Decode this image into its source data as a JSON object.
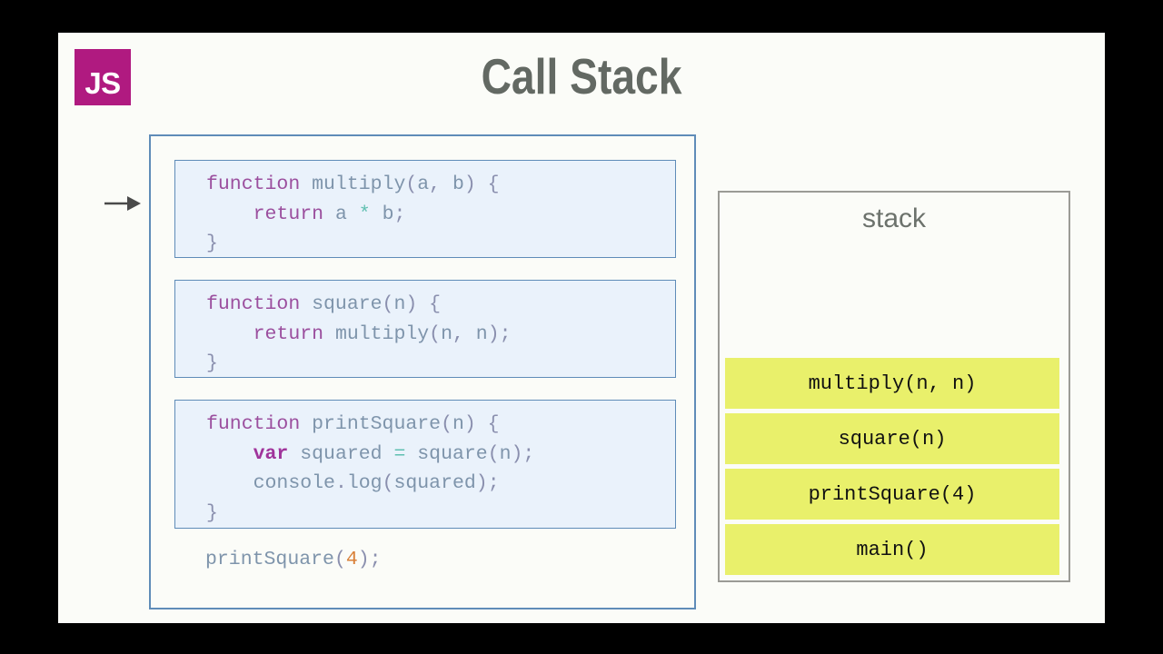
{
  "slide": {
    "title": "Call Stack",
    "logo_text": "JS",
    "logo_color": "#b01a80",
    "background": "#fbfcf8",
    "title_color": "#636963"
  },
  "pointer": {
    "icon": "right-arrow-icon",
    "points_to_line": "function multiply(a, b) {"
  },
  "code": {
    "border_color": "#5f8cb8",
    "box_fill": "#eaf2fb",
    "blocks": [
      {
        "name": "multiply",
        "lines": [
          [
            {
              "t": "function",
              "c": "kw"
            },
            {
              "t": " ",
              "c": "id"
            },
            {
              "t": "multiply",
              "c": "id"
            },
            {
              "t": "(",
              "c": "pun"
            },
            {
              "t": "a",
              "c": "id"
            },
            {
              "t": ", ",
              "c": "pun"
            },
            {
              "t": "b",
              "c": "id"
            },
            {
              "t": ") {",
              "c": "pun"
            }
          ],
          [
            {
              "t": "    ",
              "c": "id"
            },
            {
              "t": "return",
              "c": "kw"
            },
            {
              "t": " ",
              "c": "id"
            },
            {
              "t": "a",
              "c": "id"
            },
            {
              "t": " ",
              "c": "id"
            },
            {
              "t": "*",
              "c": "op"
            },
            {
              "t": " ",
              "c": "id"
            },
            {
              "t": "b",
              "c": "id"
            },
            {
              "t": ";",
              "c": "pun"
            }
          ],
          [
            {
              "t": "}",
              "c": "pun"
            }
          ]
        ]
      },
      {
        "name": "square",
        "lines": [
          [
            {
              "t": "function",
              "c": "kw"
            },
            {
              "t": " ",
              "c": "id"
            },
            {
              "t": "square",
              "c": "id"
            },
            {
              "t": "(",
              "c": "pun"
            },
            {
              "t": "n",
              "c": "id"
            },
            {
              "t": ") {",
              "c": "pun"
            }
          ],
          [
            {
              "t": "    ",
              "c": "id"
            },
            {
              "t": "return",
              "c": "kw"
            },
            {
              "t": " ",
              "c": "id"
            },
            {
              "t": "multiply",
              "c": "id"
            },
            {
              "t": "(",
              "c": "pun"
            },
            {
              "t": "n",
              "c": "id"
            },
            {
              "t": ", ",
              "c": "pun"
            },
            {
              "t": "n",
              "c": "id"
            },
            {
              "t": ");",
              "c": "pun"
            }
          ],
          [
            {
              "t": "}",
              "c": "pun"
            }
          ]
        ]
      },
      {
        "name": "printSquare",
        "lines": [
          [
            {
              "t": "function",
              "c": "kw"
            },
            {
              "t": " ",
              "c": "id"
            },
            {
              "t": "printSquare",
              "c": "id"
            },
            {
              "t": "(",
              "c": "pun"
            },
            {
              "t": "n",
              "c": "id"
            },
            {
              "t": ") {",
              "c": "pun"
            }
          ],
          [
            {
              "t": "    ",
              "c": "id"
            },
            {
              "t": "var",
              "c": "kw-b"
            },
            {
              "t": " ",
              "c": "id"
            },
            {
              "t": "squared",
              "c": "id"
            },
            {
              "t": " ",
              "c": "id"
            },
            {
              "t": "=",
              "c": "op"
            },
            {
              "t": " ",
              "c": "id"
            },
            {
              "t": "square",
              "c": "id"
            },
            {
              "t": "(",
              "c": "pun"
            },
            {
              "t": "n",
              "c": "id"
            },
            {
              "t": ");",
              "c": "pun"
            }
          ],
          [
            {
              "t": "    ",
              "c": "id"
            },
            {
              "t": "console",
              "c": "id"
            },
            {
              "t": ".",
              "c": "pun"
            },
            {
              "t": "log",
              "c": "id"
            },
            {
              "t": "(",
              "c": "pun"
            },
            {
              "t": "squared",
              "c": "id"
            },
            {
              "t": ");",
              "c": "pun"
            }
          ],
          [
            {
              "t": "}",
              "c": "pun"
            }
          ]
        ]
      }
    ],
    "tail_line": [
      {
        "t": "printSquare",
        "c": "id"
      },
      {
        "t": "(",
        "c": "pun"
      },
      {
        "t": "4",
        "c": "num"
      },
      {
        "t": ");",
        "c": "pun"
      }
    ]
  },
  "stack": {
    "title": "stack",
    "border_color": "#9b9b96",
    "frame_color": "#e9f06b",
    "frames": [
      {
        "label": "multiply(n, n)"
      },
      {
        "label": "square(n)"
      },
      {
        "label": "printSquare(4)"
      },
      {
        "label": "main()"
      }
    ]
  }
}
